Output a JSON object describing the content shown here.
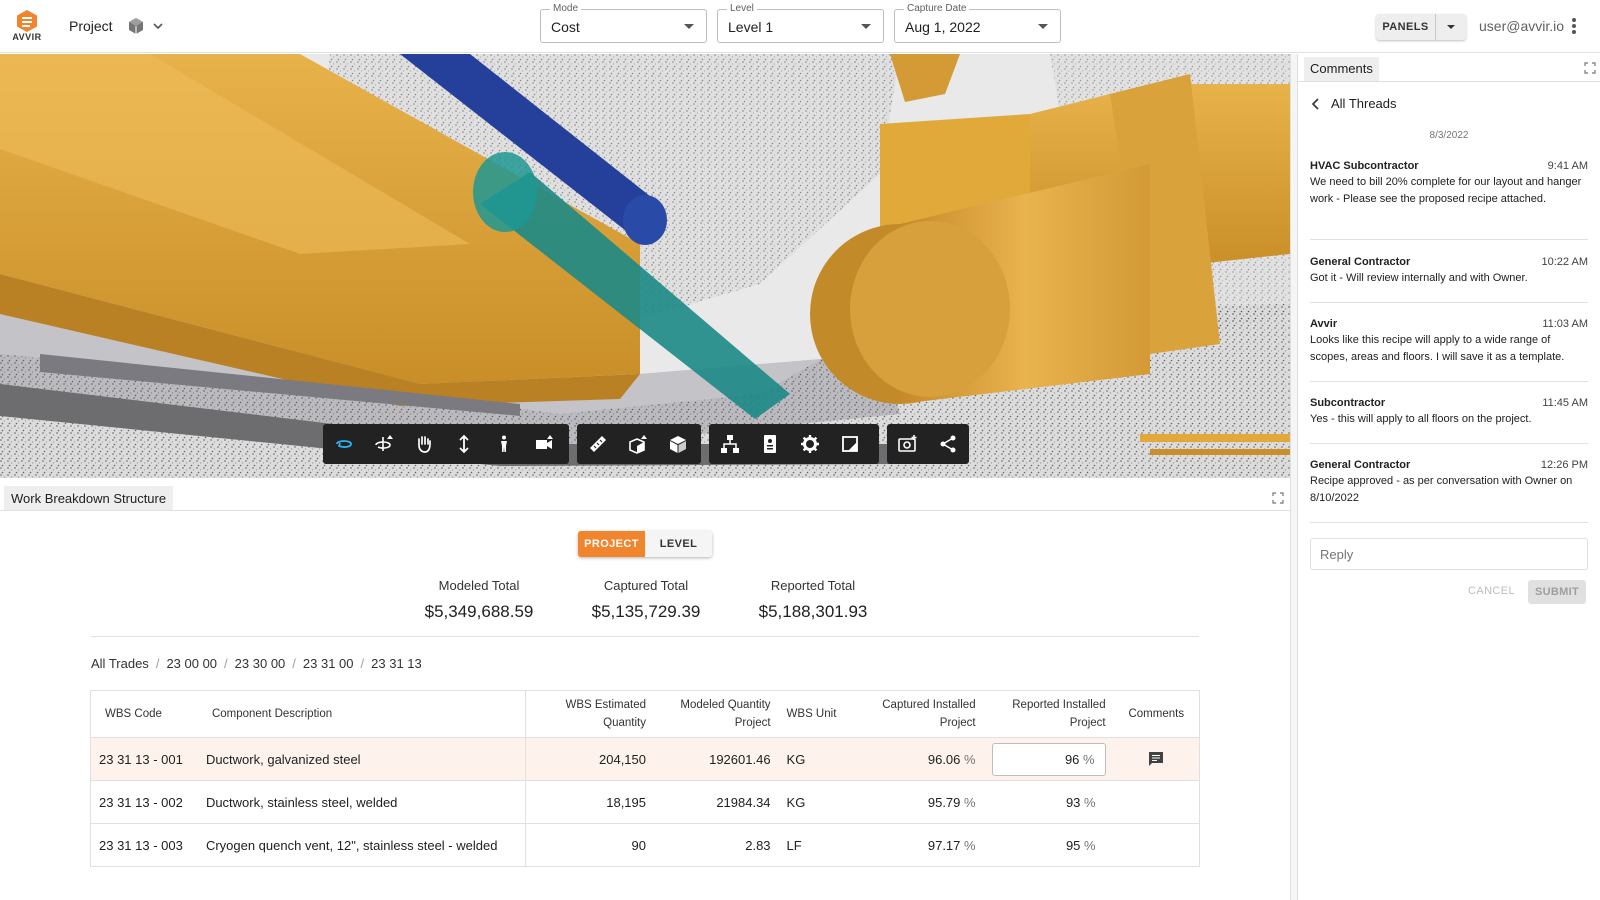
{
  "header": {
    "logo_text": "AVVIR",
    "project_label": "Project",
    "mode": {
      "label": "Mode",
      "value": "Cost"
    },
    "level": {
      "label": "Level",
      "value": "Level 1"
    },
    "capture_date": {
      "label": "Capture Date",
      "value": "Aug 1, 2022"
    },
    "panels_label": "PANELS",
    "user_email": "user@avvir.io"
  },
  "viewer": {
    "toolbar_icons": [
      "orbit-icon",
      "rotate-icon",
      "pan-hand-icon",
      "vertical-move-icon",
      "person-walk-icon",
      "camera-icon",
      "ruler-icon",
      "section-box-icon",
      "cube-icon",
      "model-tree-icon",
      "properties-icon",
      "settings-gear-icon",
      "fullscreen-icon",
      "screenshot-icon",
      "share-icon"
    ]
  },
  "wbs": {
    "tab_label": "Work Breakdown Structure",
    "toggle": {
      "project": "PROJECT",
      "level": "LEVEL"
    },
    "totals": [
      {
        "label": "Modeled Total",
        "value": "$5,349,688.59"
      },
      {
        "label": "Captured Total",
        "value": "$5,135,729.39"
      },
      {
        "label": "Reported Total",
        "value": "$5,188,301.93"
      }
    ],
    "breadcrumb": [
      "All Trades",
      "23 00 00",
      "23 30 00",
      "23 31 00",
      "23 31 13"
    ],
    "columns": {
      "code": "WBS Code",
      "desc": "Component Description",
      "est_qty": [
        "WBS Estimated",
        "Quantity"
      ],
      "mod_qty": [
        "Modeled Quantity",
        "Project"
      ],
      "unit": "WBS Unit",
      "captured": [
        "Captured Installed",
        "Project"
      ],
      "reported": [
        "Reported Installed",
        "Project"
      ],
      "comments": "Comments"
    },
    "rows": [
      {
        "code": "23 31 13 - 001",
        "desc": "Ductwork, galvanized steel",
        "est": "204,150",
        "mod": "192601.46",
        "unit": "KG",
        "captured": "96.06",
        "reported": "96"
      },
      {
        "code": "23 31 13 - 002",
        "desc": "Ductwork, stainless steel, welded",
        "est": "18,195",
        "mod": "21984.34",
        "unit": "KG",
        "captured": "95.79",
        "reported": "93"
      },
      {
        "code": "23 31 13 - 003",
        "desc": "Cryogen quench vent, 12\", stainless steel - welded",
        "est": "90",
        "mod": "2.83",
        "unit": "LF",
        "captured": "97.17",
        "reported": "95"
      }
    ],
    "pct_symbol": "%"
  },
  "comments": {
    "tab_label": "Comments",
    "back_label": "All Threads",
    "date": "8/3/2022",
    "threads": [
      {
        "author": "HVAC Subcontractor",
        "time": "9:41 AM",
        "body": "We need to bill 20% complete for our layout and hanger work - Please see the proposed recipe attached."
      },
      {
        "author": "General Contractor",
        "time": "10:22 AM",
        "body": "Got it - Will review internally and with Owner."
      },
      {
        "author": "Avvir",
        "time": "11:03 AM",
        "body": "Looks like this recipe will apply to a wide range of scopes, areas and floors. I will save it as a template."
      },
      {
        "author": "Subcontractor",
        "time": "11:45 AM",
        "body": "Yes - this will apply to all floors on the project."
      },
      {
        "author": "General Contractor",
        "time": "12:26 PM",
        "body": "Recipe approved - as per conversation with Owner on 8/10/2022"
      }
    ],
    "reply_placeholder": "Reply",
    "cancel_label": "CANCEL",
    "submit_label": "SUBMIT"
  },
  "colors": {
    "accent": "#f0852d",
    "duct_yellow": "#e0a93a",
    "pipe_blue": "#24409a",
    "pipe_teal": "#1c8a86"
  }
}
